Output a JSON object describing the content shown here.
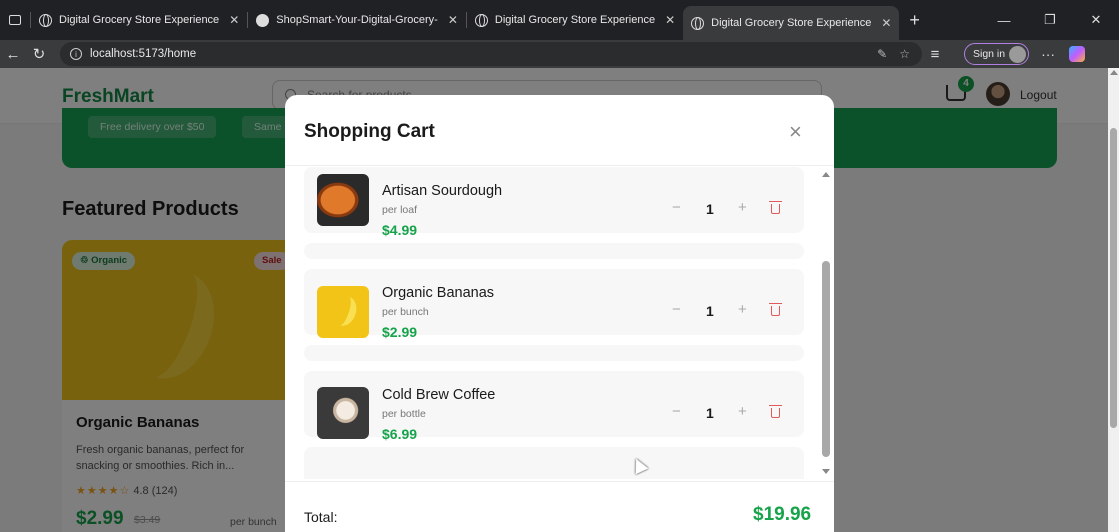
{
  "browser": {
    "tabs": [
      {
        "title": "Digital Grocery Store Experience",
        "icon": "globe-icon"
      },
      {
        "title": "ShopSmart-Your-Digital-Grocery-",
        "icon": "github-icon"
      },
      {
        "title": "Digital Grocery Store Experience",
        "icon": "globe-icon"
      },
      {
        "title": "Digital Grocery Store Experience",
        "icon": "globe-icon",
        "active": true
      }
    ],
    "url": "localhost:5173/home",
    "sign_in_label": "Sign in",
    "more_label": "···"
  },
  "site": {
    "logo": "FreshMart",
    "search_placeholder": "Search for products",
    "cart_count": "4",
    "logout_label": "Logout",
    "banner_chips": [
      "Free delivery over $50",
      "Same"
    ],
    "section_title": "Featured Products"
  },
  "featured_product": {
    "tag_organic": "Organic",
    "tag_sale": "Sale",
    "name": "Organic Bananas",
    "description": "Fresh organic bananas, perfect for snacking or smoothies. Rich in...",
    "stars": "★★★★☆",
    "rating_text": "4.8 (124)",
    "price": "$2.99",
    "old_price": "$3.49",
    "unit": "per bunch"
  },
  "cart": {
    "title": "Shopping Cart",
    "close_label": "×",
    "items": [
      {
        "name": "Artisan Sourdough",
        "unit": "per loaf",
        "price": "$4.99",
        "qty": "1",
        "thumb": "bread"
      },
      {
        "name": "Organic Bananas",
        "unit": "per bunch",
        "price": "$2.99",
        "qty": "1",
        "thumb": "banana"
      },
      {
        "name": "Cold Brew Coffee",
        "unit": "per bottle",
        "price": "$6.99",
        "qty": "1",
        "thumb": "coffee"
      }
    ],
    "minus_label": "−",
    "plus_label": "+",
    "total_label": "Total:",
    "total_value": "$19.96"
  },
  "colors": {
    "brand_green": "#16a34a",
    "banner_green": "#17a254",
    "delete_red": "#e05a5a"
  }
}
